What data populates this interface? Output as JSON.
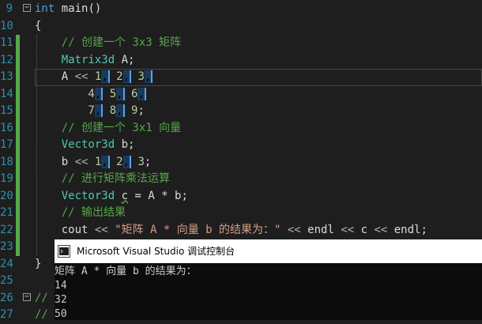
{
  "editor": {
    "lines": [
      {
        "n": "9",
        "fold": "minus",
        "parts": [
          [
            "kw",
            "int"
          ],
          [
            "id",
            " main()"
          ]
        ]
      },
      {
        "n": "10",
        "parts": [
          [
            "id",
            "{"
          ]
        ]
      },
      {
        "n": "11",
        "change": true,
        "parts": [
          [
            "cm",
            "    // 创建一个 3x3 矩阵"
          ]
        ]
      },
      {
        "n": "12",
        "change": true,
        "parts": [
          [
            "type",
            "    Matrix3d"
          ],
          [
            "id",
            " A;"
          ]
        ]
      },
      {
        "n": "13",
        "change": true,
        "current": true,
        "parts": [
          [
            "id",
            "    A "
          ],
          [
            "op",
            "<<"
          ],
          [
            "num",
            " 1"
          ],
          [
            "hl",
            ","
          ],
          [
            "num",
            " 2"
          ],
          [
            "hl",
            ","
          ],
          [
            "num",
            " 3"
          ],
          [
            "hl",
            ","
          ]
        ]
      },
      {
        "n": "14",
        "change": true,
        "parts": [
          [
            "num",
            "        4"
          ],
          [
            "hl",
            ","
          ],
          [
            "num",
            " 5"
          ],
          [
            "hl",
            ","
          ],
          [
            "num",
            " 6"
          ],
          [
            "hl",
            ","
          ]
        ]
      },
      {
        "n": "15",
        "change": true,
        "parts": [
          [
            "num",
            "        7"
          ],
          [
            "hl",
            ","
          ],
          [
            "num",
            " 8"
          ],
          [
            "hl",
            ","
          ],
          [
            "num",
            " 9"
          ],
          [
            "id",
            ";"
          ]
        ]
      },
      {
        "n": "16",
        "change": true,
        "parts": [
          [
            "cm",
            "    // 创建一个 3x1 向量"
          ]
        ]
      },
      {
        "n": "17",
        "change": true,
        "parts": [
          [
            "type",
            "    Vector3d"
          ],
          [
            "id",
            " b;"
          ]
        ]
      },
      {
        "n": "18",
        "change": true,
        "parts": [
          [
            "id",
            "    b "
          ],
          [
            "op",
            "<<"
          ],
          [
            "num",
            " 1"
          ],
          [
            "hl",
            ","
          ],
          [
            "num",
            " 2"
          ],
          [
            "hl",
            ","
          ],
          [
            "num",
            " 3"
          ],
          [
            "id",
            ";"
          ]
        ]
      },
      {
        "n": "19",
        "change": true,
        "parts": [
          [
            "cm",
            "    // 进行矩阵乘法运算"
          ]
        ]
      },
      {
        "n": "20",
        "change": true,
        "parts": [
          [
            "type",
            "    Vector3d"
          ],
          [
            "id",
            " "
          ],
          [
            "sq",
            "c"
          ],
          [
            "id",
            " = A * b;"
          ]
        ]
      },
      {
        "n": "21",
        "change": true,
        "parts": [
          [
            "cm",
            "    // 输出结果"
          ]
        ]
      },
      {
        "n": "22",
        "change": true,
        "parts": [
          [
            "id",
            "    cout "
          ],
          [
            "op",
            "<<"
          ],
          [
            "str",
            " \"矩阵 A * 向量 b 的结果为：\""
          ],
          [
            "op",
            " <<"
          ],
          [
            "id",
            " endl "
          ],
          [
            "op",
            "<<"
          ],
          [
            "id",
            " c "
          ],
          [
            "op",
            "<<"
          ],
          [
            "id",
            " endl;"
          ]
        ]
      },
      {
        "n": "23",
        "change": true,
        "parts": []
      },
      {
        "n": "24",
        "parts": [
          [
            "id",
            "}"
          ]
        ]
      },
      {
        "n": "25",
        "parts": []
      },
      {
        "n": "26",
        "fold": "minus",
        "parts": [
          [
            "cm",
            "//"
          ]
        ]
      },
      {
        "n": "27",
        "parts": [
          [
            "cm",
            "//"
          ]
        ]
      }
    ]
  },
  "console": {
    "title": "Microsoft Visual Studio 调试控制台",
    "output": [
      "矩阵 A * 向量 b 的结果为：",
      "14",
      "32",
      "50"
    ]
  },
  "colors": {
    "background": "#1e1e1e",
    "line_number": "#2b91af",
    "comment": "#57a64a",
    "keyword": "#569cd6",
    "type": "#4ec9b0"
  }
}
